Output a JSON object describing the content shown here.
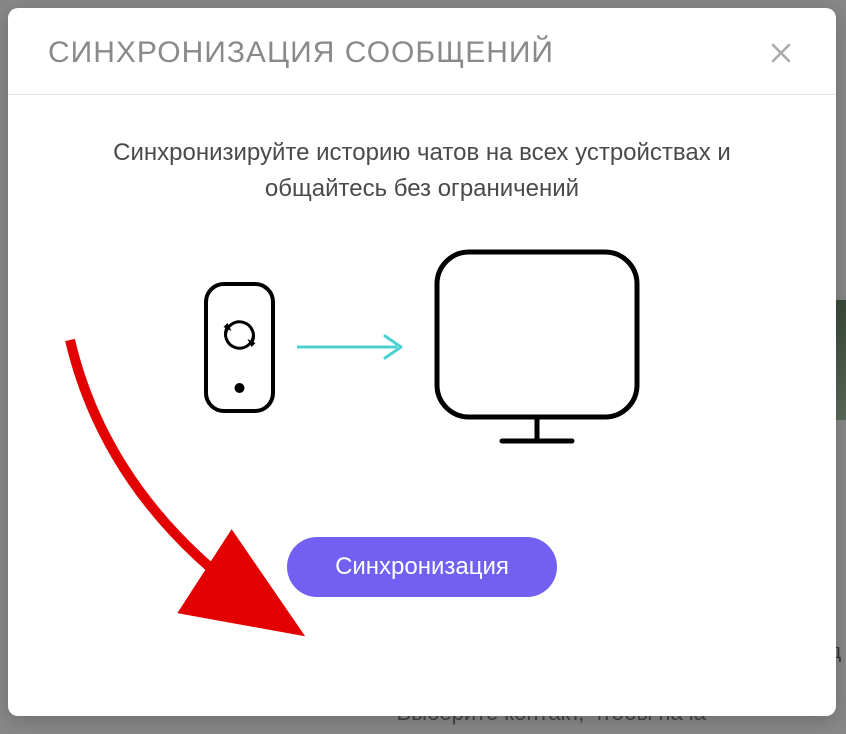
{
  "dialog": {
    "title": "СИНХРОНИЗАЦИЯ СООБЩЕНИЙ",
    "description": "Синхронизируйте историю чатов на всех устройствах и общайтесь без ограничений",
    "syncButtonLabel": "Синхронизация"
  },
  "background": {
    "partialText": "Выберите контакт, чтобы нача",
    "partialLetter": "д"
  },
  "colors": {
    "primary": "#7360f2",
    "arrow": "#4dd0d0",
    "annotate": "#e30000"
  }
}
